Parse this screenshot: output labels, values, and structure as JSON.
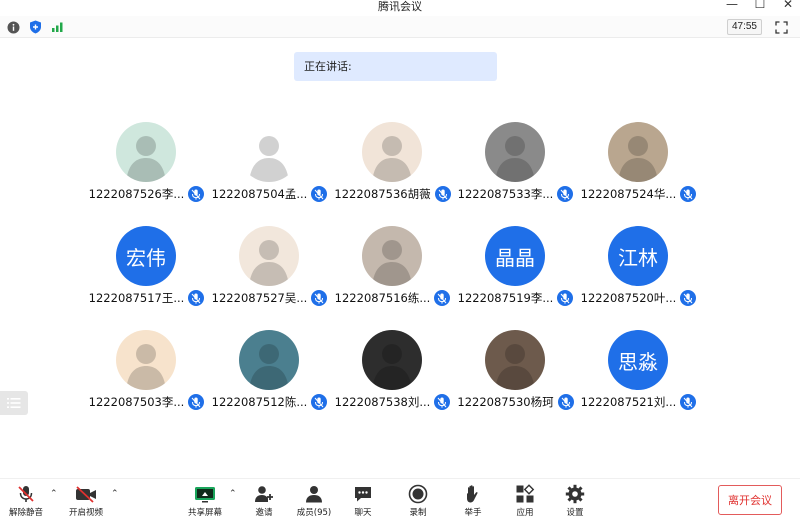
{
  "window": {
    "title": "腾讯会议",
    "minimize": "—",
    "maximize": "☐",
    "close": "✕"
  },
  "infobar": {
    "timer": "47:55",
    "icons": [
      "info-icon",
      "shield-icon",
      "signal-icon"
    ],
    "fullscreen_icon": "fullscreen-icon"
  },
  "speaking": {
    "label": "正在讲话:"
  },
  "participants": [
    {
      "name": "1222087526李...",
      "avatar": "image",
      "avatar_color": "#cfe7dd"
    },
    {
      "name": "1222087504孟...",
      "avatar": "image",
      "avatar_color": "#ffffff"
    },
    {
      "name": "1222087536胡薇",
      "avatar": "image",
      "avatar_color": "#f1e4d8"
    },
    {
      "name": "1222087533李...",
      "avatar": "image",
      "avatar_color": "#8a8a8a"
    },
    {
      "name": "1222087524华...",
      "avatar": "image",
      "avatar_color": "#b9a68f"
    },
    {
      "name": "1222087517王...",
      "avatar": "text",
      "avatar_text": "宏伟"
    },
    {
      "name": "1222087527吴...",
      "avatar": "image",
      "avatar_color": "#f2e7dc"
    },
    {
      "name": "1222087516练...",
      "avatar": "image",
      "avatar_color": "#c4b8ad"
    },
    {
      "name": "1222087519李...",
      "avatar": "text",
      "avatar_text": "晶晶"
    },
    {
      "name": "1222087520叶...",
      "avatar": "text",
      "avatar_text": "江林"
    },
    {
      "name": "1222087503李...",
      "avatar": "image",
      "avatar_color": "#f7e3cc"
    },
    {
      "name": "1222087512陈...",
      "avatar": "image",
      "avatar_color": "#4b7f8f"
    },
    {
      "name": "1222087538刘...",
      "avatar": "image",
      "avatar_color": "#2d2d2d"
    },
    {
      "name": "1222087530杨珂",
      "avatar": "image",
      "avatar_color": "#6d5a4c"
    },
    {
      "name": "1222087521刘...",
      "avatar": "text",
      "avatar_text": "思淼"
    }
  ],
  "toolbar": {
    "unmute": "解除静音",
    "start_video": "开启视频",
    "share_screen": "共享屏幕",
    "invite": "邀请",
    "members": "成员(95)",
    "chat": "聊天",
    "record": "录制",
    "raise_hand": "举手",
    "apps": "应用",
    "settings": "设置",
    "leave": "离开会议",
    "caret": "⌃"
  },
  "colors": {
    "accent": "#1f6fe8",
    "speaking_bg": "#dfeaff",
    "leave_red": "#e0312f",
    "share_green": "#1aa55b"
  }
}
